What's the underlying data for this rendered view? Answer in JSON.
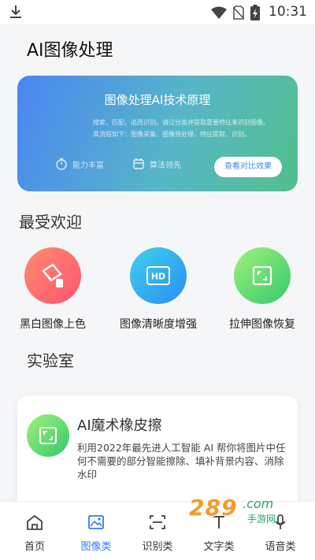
{
  "status_bar": {
    "time": "10:31"
  },
  "app": {
    "title": "AI图像处理"
  },
  "hero": {
    "title": "图像处理AI技术原理",
    "desc_line1": "搜索、匹配、追而识别。请过分类并提取重要特征来识别图像。",
    "desc_line2": "其流程如下：图像采集、图像预处理、特征提取、识别。",
    "feature1": "能力丰富",
    "feature2": "算法领先",
    "button": "查看对比效果"
  },
  "popular": {
    "heading": "最受欢迎",
    "items": [
      {
        "label": "黑白图像上色"
      },
      {
        "label": "图像清晰度增强"
      },
      {
        "label": "拉伸图像恢复"
      }
    ]
  },
  "lab": {
    "heading": "实验室",
    "card_title": "AI魔术橡皮擦",
    "card_desc": "利用2022年最先进人工智能 AI 帮你将图片中任何不需要的部分智能擦除、填补背景内容、消除水印"
  },
  "tabs": [
    {
      "label": "首页"
    },
    {
      "label": "图像类"
    },
    {
      "label": "识别类"
    },
    {
      "label": "文字类"
    },
    {
      "label": "语音类"
    }
  ],
  "watermark": {
    "number": "289",
    "suffix": ".com",
    "text": "手游网"
  },
  "colors": {
    "accent": "#2f7ff0",
    "hero_start": "#4a86f2",
    "hero_end": "#52c08c"
  }
}
